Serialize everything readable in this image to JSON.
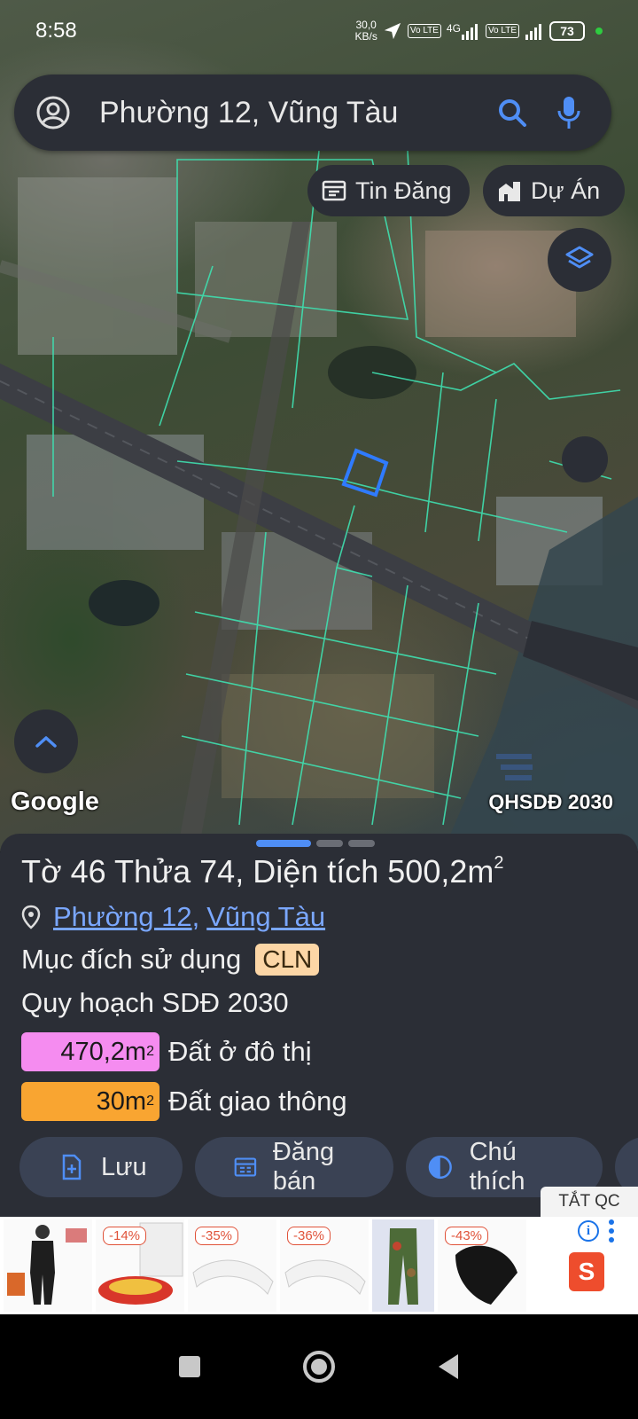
{
  "status_bar": {
    "time": "8:58",
    "net_speed_value": "30,0",
    "net_speed_unit": "KB/s",
    "sim1_label": "Vo LTE",
    "net_type": "4G",
    "sim2_label": "Vo LTE",
    "battery": "73"
  },
  "search": {
    "query": "Phường 12, Vũng Tàu"
  },
  "chips": {
    "tin_dang": "Tin Đăng",
    "du_an": "Dự Án"
  },
  "map": {
    "google_logo": "Google",
    "plan_label": "QHSDĐ 2030",
    "parcel_outline_color": "#2f7bff",
    "parcel_line_color": "#3fe0b0"
  },
  "parcel": {
    "title_prefix": "Tờ ",
    "sheet_no": "46",
    "title_mid": " Thửa ",
    "plot_no": "74",
    "title_area_label": ", Diện tích ",
    "area": "500,2m",
    "area_unit_sup": "2",
    "ward_link": "Phường 12",
    "city_link": "Vũng Tàu",
    "purpose_label": "Mục đích sử dụng",
    "purpose_code": "CLN",
    "plan_title": "Quy hoạch SDĐ 2030",
    "zones": [
      {
        "area": "470,2m",
        "sup": "2",
        "name": "Đất ở đô thị",
        "color": "#f58cf0"
      },
      {
        "area": "30m",
        "sup": "2",
        "name": "Đất giao thông",
        "color": "#f9a531"
      }
    ]
  },
  "actions": {
    "save": "Lưu",
    "post_sale": "Đăng bán",
    "legend": "Chú thích"
  },
  "ad": {
    "close_label": "TẮT QC",
    "discounts": [
      "-14%",
      "-35%",
      "-36%",
      "-43%"
    ],
    "shop_letter": "S",
    "info_letter": "i"
  }
}
